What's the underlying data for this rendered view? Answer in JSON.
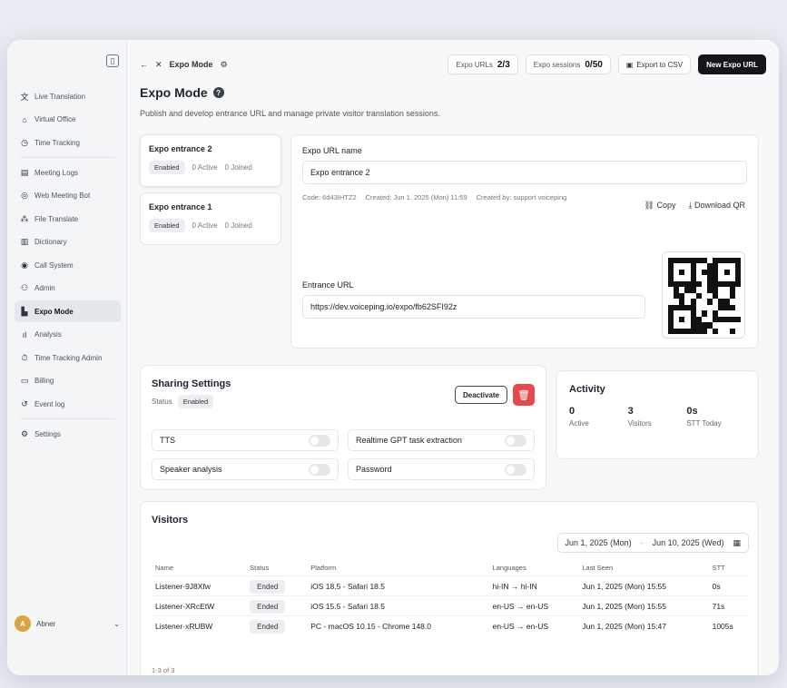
{
  "sidebar": {
    "items": [
      {
        "label": "Live Translation",
        "icon": "translate-icon",
        "active": false
      },
      {
        "label": "Virtual Office",
        "icon": "office-icon",
        "active": false
      },
      {
        "label": "Time Tracking",
        "icon": "clock-icon",
        "active": false
      },
      {
        "label": "Meeting Logs",
        "icon": "logs-icon",
        "active": false
      },
      {
        "label": "Web Meeting Bot",
        "icon": "bot-icon",
        "active": false
      },
      {
        "label": "File Translate",
        "icon": "file-icon",
        "active": false
      },
      {
        "label": "Dictionary",
        "icon": "book-icon",
        "active": false
      },
      {
        "label": "Call System",
        "icon": "phone-icon",
        "active": false
      },
      {
        "label": "Admin",
        "icon": "admin-icon",
        "active": false
      },
      {
        "label": "Expo Mode",
        "icon": "expo-icon",
        "active": true
      },
      {
        "label": "Analysis",
        "icon": "chart-icon",
        "active": false
      },
      {
        "label": "Time Tracking Admin",
        "icon": "timer-icon",
        "active": false
      },
      {
        "label": "Billing",
        "icon": "card-icon",
        "active": false
      },
      {
        "label": "Event log",
        "icon": "history-icon",
        "active": false
      },
      {
        "label": "Settings",
        "icon": "gear-icon",
        "active": false
      }
    ],
    "user": {
      "name": "Abner",
      "initial": "A"
    }
  },
  "header": {
    "back": "←",
    "close": "✕",
    "crumb_title": "Expo Mode",
    "expo_urls_label": "Expo URLs",
    "expo_urls_value": "2/3",
    "expo_sessions_label": "Expo sessions",
    "expo_sessions_value": "0/50",
    "export_csv": "Export to CSV",
    "new_expo_url": "New Expo URL"
  },
  "page": {
    "title": "Expo Mode",
    "subtitle": "Publish and develop entrance URL and manage private visitor translation sessions."
  },
  "entrances": [
    {
      "name": "Expo entrance 2",
      "status": "Enabled",
      "active": "0 Active",
      "joined": "0 Joined"
    },
    {
      "name": "Expo entrance 1",
      "status": "Enabled",
      "active": "0 Active",
      "joined": "0 Joined"
    }
  ],
  "detail": {
    "url_name_label": "Expo URL name",
    "url_name_value": "Expo entrance 2",
    "code": "Code: 6d43IHTZ2",
    "created": "Created: Jun 1, 2025 (Mon) 11:59",
    "created_by": "Created by: support voiceping",
    "copy": "Copy",
    "download_qr": "Download QR",
    "entrance_url_label": "Entrance URL",
    "entrance_url_value": "https://dev.voiceping.io/expo/fb62SFI92z"
  },
  "sharing": {
    "title": "Sharing Settings",
    "status_label": "Status",
    "status_value": "Enabled",
    "deactivate": "Deactivate",
    "toggles": [
      {
        "label": "TTS",
        "on": false
      },
      {
        "label": "Realtime GPT task extraction",
        "on": false
      },
      {
        "label": "Speaker analysis",
        "on": false
      },
      {
        "label": "Password",
        "on": false
      }
    ]
  },
  "activity": {
    "title": "Activity",
    "stats": [
      {
        "value": "0",
        "label": "Active"
      },
      {
        "value": "3",
        "label": "Visitors"
      },
      {
        "value": "0s",
        "label": "STT Today"
      }
    ]
  },
  "visitors": {
    "title": "Visitors",
    "date_from": "Jun 1, 2025 (Mon)",
    "date_sep": "-",
    "date_to": "Jun 10, 2025 (Wed)",
    "columns": [
      "Name",
      "Status",
      "Platform",
      "Languages",
      "Last Seen",
      "STT"
    ],
    "rows": [
      {
        "name": "Listener-9J8Xfw",
        "status": "Ended",
        "platform": "iOS 18.5 - Safari 18.5",
        "languages": "hi-IN → hi-IN",
        "last_seen": "Jun 1, 2025 (Mon) 15:55",
        "stt": "0s"
      },
      {
        "name": "Listener-XRcEtW",
        "status": "Ended",
        "platform": "iOS 15.5 - Safari 18.5",
        "languages": "en-US → en-US",
        "last_seen": "Jun 1, 2025 (Mon) 15:55",
        "stt": "71s"
      },
      {
        "name": "Listener-xRUBW",
        "status": "Ended",
        "platform": "PC - macOS 10.15 - Chrome 148.0",
        "languages": "en-US → en-US",
        "last_seen": "Jun 1, 2025 (Mon) 15:47",
        "stt": "1005s"
      }
    ],
    "pager": "1-3 of 3"
  },
  "colors": {
    "accent_dark": "#14161b",
    "danger": "#e5484d",
    "bg": "#f7f8fa"
  }
}
